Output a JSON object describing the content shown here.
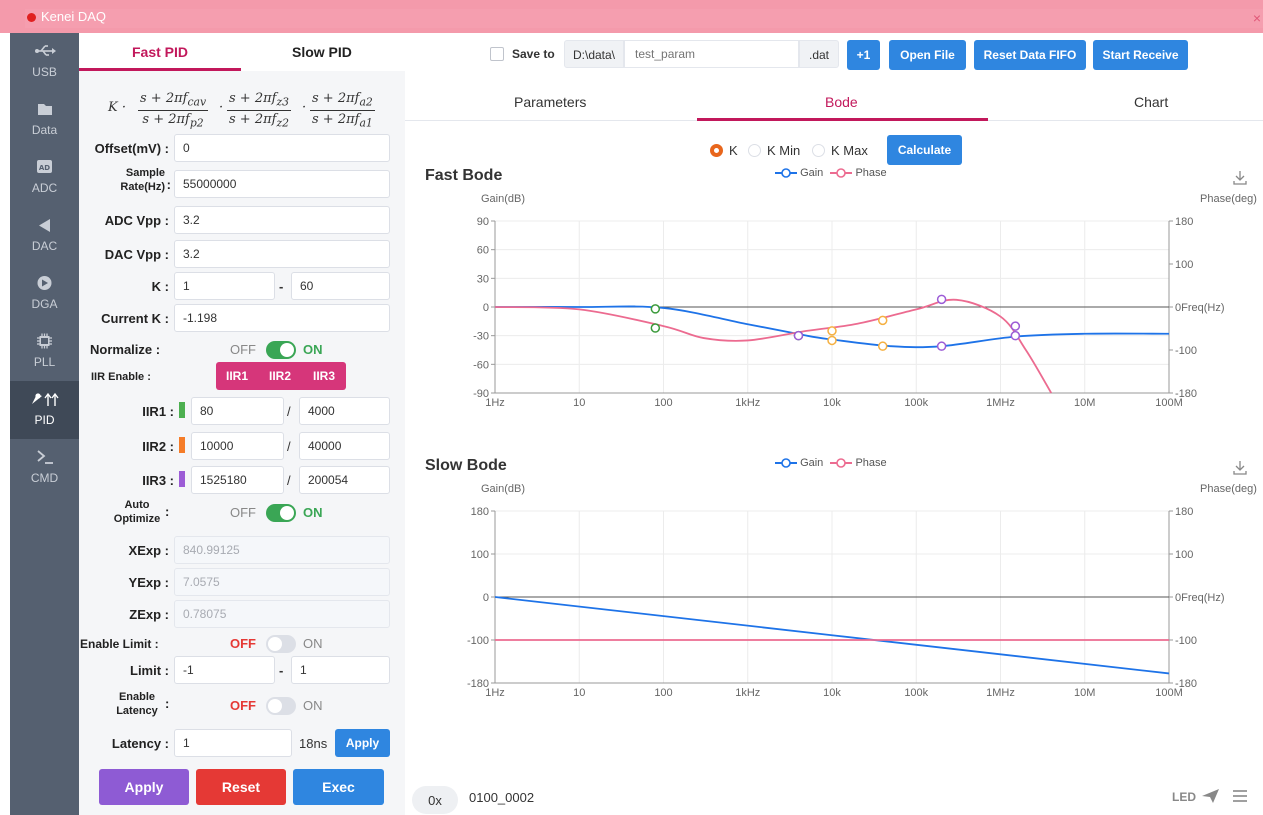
{
  "window": {
    "title": "Kenei DAQ",
    "close_glyph": "×"
  },
  "sidebar": {
    "items": [
      {
        "label": "USB",
        "icon": "usb-icon"
      },
      {
        "label": "Data",
        "icon": "folder-icon"
      },
      {
        "label": "ADC",
        "icon": "adc-icon"
      },
      {
        "label": "DAC",
        "icon": "play-left-icon"
      },
      {
        "label": "DGA",
        "icon": "play-circle-icon"
      },
      {
        "label": "PLL",
        "icon": "chip-icon"
      },
      {
        "label": "PID",
        "icon": "pid-icon"
      },
      {
        "label": "CMD",
        "icon": "terminal-icon"
      }
    ],
    "active": "PID"
  },
  "pid": {
    "tabs": [
      "Fast PID",
      "Slow PID"
    ],
    "formula": {
      "prefix": "K ·",
      "fracs": [
        {
          "num": "s + 2πf",
          "num_sub": "cav",
          "den": "s + 2πf",
          "den_sub": "p2"
        },
        {
          "num": "s + 2πf",
          "num_sub": "z3",
          "den": "s + 2πf",
          "den_sub": "z2"
        },
        {
          "num": "s + 2πf",
          "num_sub": "a2",
          "den": "s + 2πf",
          "den_sub": "a1"
        }
      ],
      "dot": "·"
    },
    "offset": {
      "label": "Offset(mV) :",
      "value": "0"
    },
    "sample_rate": {
      "label1": "Sample",
      "label2": "Rate(Hz)",
      "colon": ":",
      "value": "55000000"
    },
    "adc_vpp": {
      "label": "ADC Vpp :",
      "value": "3.2"
    },
    "dac_vpp": {
      "label": "DAC Vpp :",
      "value": "3.2"
    },
    "k": {
      "label": "K :",
      "min": "1",
      "sep": "-",
      "max": "60"
    },
    "current_k": {
      "label": "Current K :",
      "value": "-1.198"
    },
    "normalize": {
      "label": "Normalize :",
      "off": "OFF",
      "on": "ON"
    },
    "iir_enable": {
      "label": "IIR Enable :",
      "buttons": [
        "IIR1",
        "IIR2",
        "IIR3"
      ]
    },
    "iir": [
      {
        "label": "IIR1 :",
        "a": "80",
        "b": "4000",
        "color": "#4caf50"
      },
      {
        "label": "IIR2 :",
        "a": "10000",
        "b": "40000",
        "color": "#f57c28"
      },
      {
        "label": "IIR3 :",
        "a": "1525180",
        "b": "200054",
        "color": "#9c5cd6"
      }
    ],
    "iir_sep": "/",
    "auto_opt": {
      "label1": "Auto",
      "label2": "Optimize",
      "colon": ":",
      "off": "OFF",
      "on": "ON"
    },
    "xexp": {
      "label": "XExp :",
      "value": "840.99125"
    },
    "yexp": {
      "label": "YExp :",
      "value": "7.0575"
    },
    "zexp": {
      "label": "ZExp :",
      "value": "0.78075"
    },
    "enable_limit": {
      "label": "Enable Limit :",
      "off": "OFF",
      "on": "ON"
    },
    "limit": {
      "label": "Limit :",
      "min": "-1",
      "sep": "-",
      "max": "1"
    },
    "enable_latency": {
      "label1": "Enable",
      "label2": "Latency",
      "colon": ":",
      "off": "OFF",
      "on": "ON"
    },
    "latency": {
      "label": "Latency :",
      "value": "1",
      "unit": "18ns",
      "apply": "Apply"
    },
    "actions": {
      "apply": "Apply",
      "reset": "Reset",
      "exec": "Exec"
    }
  },
  "toolbar": {
    "save_to": "Save to",
    "path": "D:\\data\\",
    "filename_placeholder": "test_param",
    "ext": ".dat",
    "plus_one": "+1",
    "open_file": "Open File",
    "reset_fifo": "Reset Data FIFO",
    "start_receive": "Start Receive"
  },
  "main_tabs": [
    "Parameters",
    "Bode",
    "Chart"
  ],
  "active_tab": "Bode",
  "k_select": {
    "options": [
      "K",
      "K Min",
      "K Max"
    ],
    "selected": "K",
    "calculate": "Calculate"
  },
  "fast_bode": {
    "title": "Fast Bode",
    "legend": [
      "Gain",
      "Phase"
    ],
    "y_left_label": "Gain(dB)",
    "y_right_label": "Phase(deg)",
    "y_left_ticks": [
      "90",
      "60",
      "30",
      "0",
      "-30",
      "-60",
      "-90"
    ],
    "y_right_ticks": [
      "180",
      "100",
      "0Freq(Hz)",
      "-100",
      "-180"
    ],
    "x_ticks": [
      "1Hz",
      "10",
      "100",
      "1kHz",
      "10k",
      "100k",
      "1MHz",
      "10M",
      "100M"
    ]
  },
  "slow_bode": {
    "title": "Slow Bode",
    "legend": [
      "Gain",
      "Phase"
    ],
    "y_left_label": "Gain(dB)",
    "y_right_label": "Phase(deg)",
    "y_left_ticks": [
      "180",
      "100",
      "0",
      "-100",
      "-180"
    ],
    "y_right_ticks": [
      "180",
      "100",
      "0Freq(Hz)",
      "-100",
      "-180"
    ],
    "x_ticks": [
      "1Hz",
      "10",
      "100",
      "1kHz",
      "10k",
      "100k",
      "1MHz",
      "10M",
      "100M"
    ]
  },
  "chart_data": [
    {
      "type": "line",
      "title": "Fast Bode",
      "xlabel": "Freq(Hz)",
      "ylabel": "Gain(dB)",
      "y2label": "Phase(deg)",
      "x_scale": "log",
      "xlim": [
        1,
        100000000
      ],
      "ylim": [
        -90,
        90
      ],
      "y2lim": [
        -180,
        180
      ],
      "series": [
        {
          "name": "Gain",
          "color": "#1e73e8",
          "axis": "left",
          "x": [
            1,
            10,
            100,
            1000,
            5000,
            10000,
            50000,
            200000,
            1500000,
            10000000,
            100000000
          ],
          "y": [
            0,
            0,
            -1,
            -18,
            -30,
            -34,
            -41,
            -41,
            -31,
            -28,
            -28
          ]
        },
        {
          "name": "Phase",
          "color": "#ec6b90",
          "axis": "right",
          "x": [
            1,
            10,
            100,
            300,
            1000,
            5000,
            20000,
            100000,
            300000,
            1000000,
            2000000,
            4000000
          ],
          "y": [
            0,
            -5,
            -40,
            -65,
            -70,
            -50,
            -35,
            -5,
            15,
            -20,
            -90,
            -180
          ]
        }
      ],
      "markers": [
        {
          "x": 80,
          "y": -2,
          "color": "#3a9a3a"
        },
        {
          "x": 80,
          "y": -22,
          "color": "#3a9a3a"
        },
        {
          "x": 4000,
          "y": -30,
          "color": "#3a9a3a"
        },
        {
          "x": 4000,
          "y": -30,
          "color": "#9c5cd6"
        },
        {
          "x": 10000,
          "y": -25,
          "color": "#f5b041"
        },
        {
          "x": 10000,
          "y": -35,
          "color": "#f5b041"
        },
        {
          "x": 40000,
          "y": -14,
          "color": "#f5b041"
        },
        {
          "x": 40000,
          "y": -41,
          "color": "#f5b041"
        },
        {
          "x": 200000,
          "y": 8,
          "color": "#9c5cd6"
        },
        {
          "x": 200000,
          "y": -41,
          "color": "#9c5cd6"
        },
        {
          "x": 1500000,
          "y": -20,
          "color": "#9c5cd6"
        },
        {
          "x": 1500000,
          "y": -30,
          "color": "#9c5cd6"
        }
      ]
    },
    {
      "type": "line",
      "title": "Slow Bode",
      "xlabel": "Freq(Hz)",
      "ylabel": "Gain(dB)",
      "y2label": "Phase(deg)",
      "x_scale": "log",
      "xlim": [
        1,
        100000000
      ],
      "ylim": [
        -180,
        180
      ],
      "y2lim": [
        -180,
        180
      ],
      "series": [
        {
          "name": "Gain",
          "color": "#1e73e8",
          "axis": "left",
          "x": [
            1,
            100000000
          ],
          "y": [
            0,
            -160
          ]
        },
        {
          "name": "Phase",
          "color": "#ec6b90",
          "axis": "right",
          "x": [
            1,
            100000000
          ],
          "y": [
            -90,
            -90
          ]
        }
      ]
    }
  ],
  "status": {
    "hex_prefix": "0x",
    "hex_value": "0100_0002",
    "led": "LED"
  }
}
